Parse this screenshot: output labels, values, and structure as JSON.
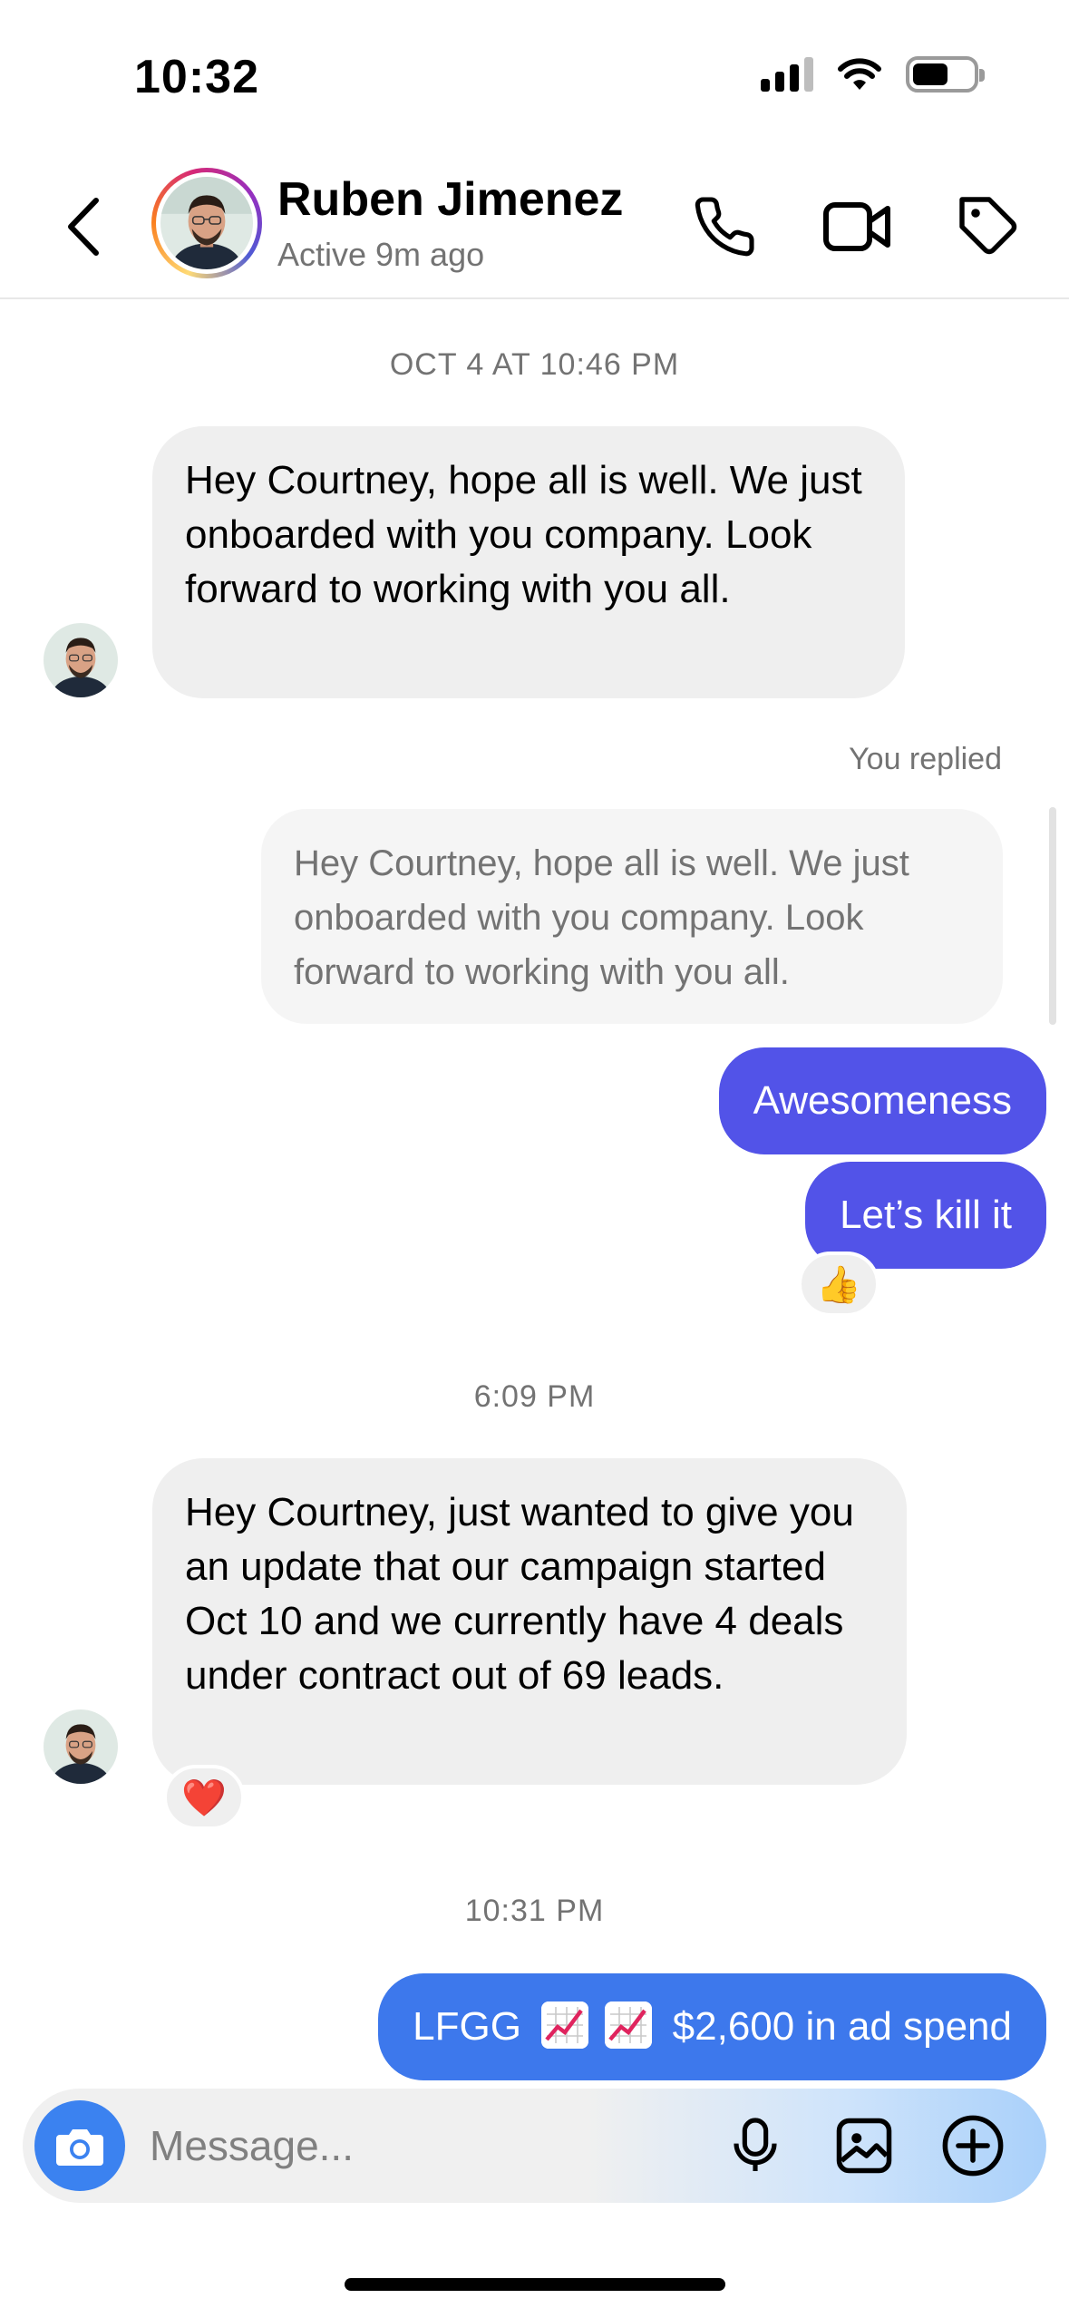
{
  "status_bar": {
    "time": "10:32"
  },
  "header": {
    "name": "Ruben Jimenez",
    "status": "Active 9m ago"
  },
  "messages": {
    "timestamp_1": "OCT 4 AT 10:46 PM",
    "incoming_1": "Hey Courtney, hope all is well. We just onboarded with you company. Look forward to working with you all.",
    "replied_label": "You replied",
    "quoted_reply": "Hey Courtney, hope all is well. We just onboarded with you company. Look forward to working with you all.",
    "outgoing_1": "Awesomeness",
    "outgoing_2": "Let’s kill it",
    "reaction_1": "👍",
    "timestamp_2": "6:09 PM",
    "incoming_2": "Hey Courtney, just wanted to give you an update that our campaign started Oct 10 and we currently have 4 deals under contract out of 69 leads.",
    "reaction_2": "❤️",
    "timestamp_3": "10:31 PM",
    "outgoing_3_prefix": "LFGG",
    "outgoing_3_suffix": "$2,600 in ad spend"
  },
  "composer": {
    "placeholder": "Message..."
  },
  "colors": {
    "outgoing_bubble": "#5253e8",
    "outgoing_bubble_latest": "#3d78ec",
    "incoming_bubble": "#efefef",
    "camera_button": "#3b82f0"
  },
  "icons": {
    "back": "chevron-left-icon",
    "call": "phone-icon",
    "video": "video-camera-icon",
    "tag": "tag-icon",
    "camera": "camera-icon",
    "mic": "microphone-icon",
    "gallery": "image-icon",
    "add": "plus-circle-icon",
    "trend": "chart-increasing-emoji"
  }
}
